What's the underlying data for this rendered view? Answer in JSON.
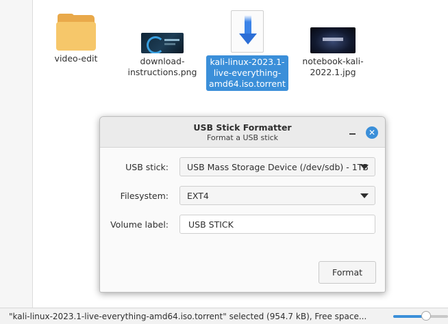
{
  "files": [
    {
      "name": "video-edit",
      "icon": "folder-icon"
    },
    {
      "name": "download-\ninstructions.png",
      "icon": "image-thumbnail"
    },
    {
      "name": "kali-linux-2023.1-\nlive-everything-\namd64.iso.torrent",
      "icon": "torrent-download-icon",
      "selected": true
    },
    {
      "name": "notebook-kali-\n2022.1.jpg",
      "icon": "image-thumbnail"
    }
  ],
  "dialog": {
    "title": "USB Stick Formatter",
    "subtitle": "Format a USB stick",
    "usb_label": "USB stick:",
    "usb_value": "USB Mass Storage Device (/dev/sdb) - 1TB",
    "fs_label": "Filesystem:",
    "fs_value": "EXT4",
    "vol_label": "Volume label:",
    "vol_value": "USB STICK",
    "format_button": "Format"
  },
  "statusbar": {
    "text": "\"kali-linux-2023.1-live-everything-amd64.iso.torrent\" selected (954.7 kB), Free space...",
    "zoom_fraction": 0.6
  },
  "colors": {
    "accent": "#3b8fd9",
    "folder": "#f6c76a"
  }
}
